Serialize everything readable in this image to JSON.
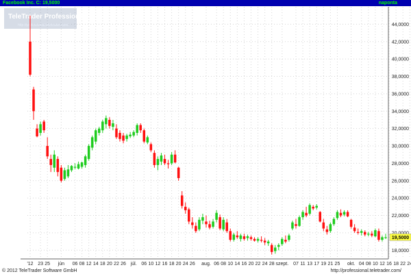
{
  "header": {
    "symbol_label": "Facebook Inc.  C: 19,5000",
    "period_label": "naponta"
  },
  "watermark": {
    "title": "TeleTrader Professional",
    "url": "http://professional.teletrader.com/"
  },
  "footer": {
    "copyright": "© 2012 TeleTrader Software GmbH",
    "url": "http://professional.teletrader.com/"
  },
  "colors": {
    "up": "#1fcc1f",
    "down": "#ff1010",
    "header_bg": "#0000b0",
    "header_text": "#00ff00",
    "grid": "#d4d4d4",
    "last_price_bg": "#ffff40"
  },
  "chart_data": {
    "type": "candlestick",
    "ylim": [
      17,
      46
    ],
    "yticks": [
      18,
      20,
      22,
      24,
      26,
      28,
      30,
      32,
      34,
      36,
      38,
      40,
      42,
      44
    ],
    "ytick_labels": [
      "18,0000",
      "20,0000",
      "22,0000",
      "24,0000",
      "26,0000",
      "28,0000",
      "30,0000",
      "32,0000",
      "34,0000",
      "36,0000",
      "38,0000",
      "40,0000",
      "42,0000",
      "44,0000"
    ],
    "grid": true,
    "last_price": 19.5,
    "last_price_label": "19,5000",
    "xtick_labels": [
      {
        "i": 0,
        "label": "'12"
      },
      {
        "i": 3,
        "label": "23"
      },
      {
        "i": 5,
        "label": "25"
      },
      {
        "i": 9,
        "label": "jún"
      },
      {
        "i": 13,
        "label": "06"
      },
      {
        "i": 15,
        "label": "08"
      },
      {
        "i": 17,
        "label": "12"
      },
      {
        "i": 19,
        "label": "14"
      },
      {
        "i": 21,
        "label": "18"
      },
      {
        "i": 23,
        "label": "20"
      },
      {
        "i": 25,
        "label": "22"
      },
      {
        "i": 27,
        "label": "26"
      },
      {
        "i": 30,
        "label": "júl."
      },
      {
        "i": 33,
        "label": "06"
      },
      {
        "i": 35,
        "label": "10"
      },
      {
        "i": 37,
        "label": "12"
      },
      {
        "i": 39,
        "label": "16"
      },
      {
        "i": 41,
        "label": "18"
      },
      {
        "i": 43,
        "label": "20"
      },
      {
        "i": 45,
        "label": "24"
      },
      {
        "i": 47,
        "label": "26"
      },
      {
        "i": 51,
        "label": "aug."
      },
      {
        "i": 54,
        "label": "06"
      },
      {
        "i": 56,
        "label": "08"
      },
      {
        "i": 58,
        "label": "10"
      },
      {
        "i": 60,
        "label": "14"
      },
      {
        "i": 62,
        "label": "16"
      },
      {
        "i": 64,
        "label": "20"
      },
      {
        "i": 66,
        "label": "22"
      },
      {
        "i": 68,
        "label": "24"
      },
      {
        "i": 70,
        "label": "28"
      },
      {
        "i": 73,
        "label": "szept."
      },
      {
        "i": 77,
        "label": "07"
      },
      {
        "i": 79,
        "label": "11"
      },
      {
        "i": 81,
        "label": "13"
      },
      {
        "i": 83,
        "label": "17"
      },
      {
        "i": 85,
        "label": "19"
      },
      {
        "i": 87,
        "label": "21"
      },
      {
        "i": 89,
        "label": "25"
      },
      {
        "i": 93,
        "label": "okt."
      },
      {
        "i": 96,
        "label": "04"
      },
      {
        "i": 98,
        "label": "08"
      },
      {
        "i": 100,
        "label": "10"
      },
      {
        "i": 102,
        "label": "12"
      },
      {
        "i": 104,
        "label": "16"
      },
      {
        "i": 106,
        "label": "18"
      },
      {
        "i": 108,
        "label": "22"
      },
      {
        "i": 110,
        "label": "24"
      }
    ],
    "candles": [
      {
        "o": 42.0,
        "h": 45.0,
        "l": 38.0,
        "c": 38.2
      },
      {
        "o": 36.5,
        "h": 36.8,
        "l": 33.0,
        "c": 34.0
      },
      {
        "o": 32.0,
        "h": 32.5,
        "l": 31.0,
        "c": 31.1
      },
      {
        "o": 31.5,
        "h": 32.8,
        "l": 31.2,
        "c": 32.5
      },
      {
        "o": 32.8,
        "h": 33.0,
        "l": 31.5,
        "c": 31.8
      },
      {
        "o": 30.0,
        "h": 31.0,
        "l": 28.5,
        "c": 28.8
      },
      {
        "o": 28.5,
        "h": 29.0,
        "l": 27.0,
        "c": 27.8
      },
      {
        "o": 27.5,
        "h": 29.5,
        "l": 27.0,
        "c": 29.0
      },
      {
        "o": 28.5,
        "h": 28.8,
        "l": 26.5,
        "c": 27.0
      },
      {
        "o": 27.5,
        "h": 27.8,
        "l": 25.8,
        "c": 26.0
      },
      {
        "o": 26.2,
        "h": 27.5,
        "l": 26.0,
        "c": 27.2
      },
      {
        "o": 26.5,
        "h": 27.8,
        "l": 26.3,
        "c": 27.3
      },
      {
        "o": 27.2,
        "h": 27.8,
        "l": 27.0,
        "c": 27.7
      },
      {
        "o": 27.5,
        "h": 28.0,
        "l": 27.3,
        "c": 27.6
      },
      {
        "o": 27.4,
        "h": 28.2,
        "l": 27.3,
        "c": 27.9
      },
      {
        "o": 27.6,
        "h": 28.2,
        "l": 27.4,
        "c": 28.1
      },
      {
        "o": 27.8,
        "h": 29.0,
        "l": 27.5,
        "c": 28.8
      },
      {
        "o": 28.5,
        "h": 30.2,
        "l": 28.3,
        "c": 30.0
      },
      {
        "o": 29.8,
        "h": 31.2,
        "l": 29.5,
        "c": 31.0
      },
      {
        "o": 30.5,
        "h": 32.0,
        "l": 30.2,
        "c": 31.8
      },
      {
        "o": 31.5,
        "h": 32.2,
        "l": 31.2,
        "c": 32.0
      },
      {
        "o": 31.8,
        "h": 33.0,
        "l": 31.5,
        "c": 32.8
      },
      {
        "o": 32.5,
        "h": 33.5,
        "l": 32.0,
        "c": 33.2
      },
      {
        "o": 33.0,
        "h": 33.3,
        "l": 32.0,
        "c": 32.3
      },
      {
        "o": 32.2,
        "h": 33.0,
        "l": 31.8,
        "c": 32.6
      },
      {
        "o": 32.0,
        "h": 32.5,
        "l": 30.8,
        "c": 31.0
      },
      {
        "o": 31.5,
        "h": 31.8,
        "l": 30.5,
        "c": 30.8
      },
      {
        "o": 31.2,
        "h": 31.5,
        "l": 30.3,
        "c": 30.6
      },
      {
        "o": 30.8,
        "h": 31.4,
        "l": 30.5,
        "c": 31.2
      },
      {
        "o": 31.1,
        "h": 31.6,
        "l": 30.9,
        "c": 31.3
      },
      {
        "o": 31.2,
        "h": 31.8,
        "l": 31.0,
        "c": 31.6
      },
      {
        "o": 31.5,
        "h": 32.6,
        "l": 31.2,
        "c": 32.4
      },
      {
        "o": 32.4,
        "h": 32.6,
        "l": 31.5,
        "c": 31.8
      },
      {
        "o": 31.8,
        "h": 32.0,
        "l": 30.3,
        "c": 30.5
      },
      {
        "o": 30.4,
        "h": 31.2,
        "l": 30.2,
        "c": 31.0
      },
      {
        "o": 30.2,
        "h": 30.4,
        "l": 29.3,
        "c": 29.5
      },
      {
        "o": 29.2,
        "h": 29.5,
        "l": 27.5,
        "c": 27.8
      },
      {
        "o": 27.8,
        "h": 28.8,
        "l": 27.2,
        "c": 28.5
      },
      {
        "o": 28.2,
        "h": 29.2,
        "l": 27.8,
        "c": 28.9
      },
      {
        "o": 28.5,
        "h": 29.0,
        "l": 27.8,
        "c": 28.0
      },
      {
        "o": 28.0,
        "h": 28.4,
        "l": 27.4,
        "c": 27.9
      },
      {
        "o": 28.0,
        "h": 29.3,
        "l": 27.8,
        "c": 29.0
      },
      {
        "o": 29.0,
        "h": 29.5,
        "l": 28.0,
        "c": 28.1
      },
      {
        "o": 27.5,
        "h": 27.6,
        "l": 26.0,
        "c": 26.3
      },
      {
        "o": 24.3,
        "h": 24.8,
        "l": 22.8,
        "c": 23.1
      },
      {
        "o": 23.0,
        "h": 23.5,
        "l": 22.2,
        "c": 22.6
      },
      {
        "o": 22.7,
        "h": 22.9,
        "l": 21.0,
        "c": 21.3
      },
      {
        "o": 21.2,
        "h": 21.8,
        "l": 20.5,
        "c": 20.9
      },
      {
        "o": 20.8,
        "h": 21.2,
        "l": 20.0,
        "c": 20.2
      },
      {
        "o": 20.4,
        "h": 21.8,
        "l": 20.2,
        "c": 21.5
      },
      {
        "o": 21.4,
        "h": 22.2,
        "l": 21.0,
        "c": 21.8
      },
      {
        "o": 21.3,
        "h": 22.0,
        "l": 20.6,
        "c": 21.0
      },
      {
        "o": 21.0,
        "h": 21.4,
        "l": 20.4,
        "c": 20.6
      },
      {
        "o": 20.7,
        "h": 21.6,
        "l": 20.5,
        "c": 21.3
      },
      {
        "o": 21.5,
        "h": 22.6,
        "l": 21.2,
        "c": 22.3
      },
      {
        "o": 21.8,
        "h": 22.1,
        "l": 20.3,
        "c": 20.5
      },
      {
        "o": 20.4,
        "h": 21.8,
        "l": 20.2,
        "c": 21.5
      },
      {
        "o": 21.2,
        "h": 21.6,
        "l": 20.0,
        "c": 20.2
      },
      {
        "o": 20.2,
        "h": 20.5,
        "l": 19.0,
        "c": 19.2
      },
      {
        "o": 19.2,
        "h": 20.0,
        "l": 19.0,
        "c": 19.8
      },
      {
        "o": 19.7,
        "h": 20.2,
        "l": 19.3,
        "c": 19.5
      },
      {
        "o": 19.3,
        "h": 19.9,
        "l": 19.0,
        "c": 19.7
      },
      {
        "o": 19.6,
        "h": 19.9,
        "l": 19.1,
        "c": 19.3
      },
      {
        "o": 19.4,
        "h": 19.8,
        "l": 19.1,
        "c": 19.6
      },
      {
        "o": 19.5,
        "h": 19.7,
        "l": 19.1,
        "c": 19.3
      },
      {
        "o": 19.3,
        "h": 19.5,
        "l": 19.0,
        "c": 19.1
      },
      {
        "o": 19.1,
        "h": 19.5,
        "l": 18.9,
        "c": 19.3
      },
      {
        "o": 19.2,
        "h": 19.6,
        "l": 18.9,
        "c": 19.1
      },
      {
        "o": 19.1,
        "h": 19.4,
        "l": 18.6,
        "c": 18.9
      },
      {
        "o": 18.8,
        "h": 19.2,
        "l": 18.5,
        "c": 19.0
      },
      {
        "o": 18.6,
        "h": 18.8,
        "l": 17.5,
        "c": 17.8
      },
      {
        "o": 17.9,
        "h": 18.6,
        "l": 17.6,
        "c": 18.3
      },
      {
        "o": 18.4,
        "h": 18.8,
        "l": 18.0,
        "c": 18.6
      },
      {
        "o": 18.7,
        "h": 19.5,
        "l": 18.5,
        "c": 19.3
      },
      {
        "o": 19.2,
        "h": 19.7,
        "l": 18.8,
        "c": 19.0
      },
      {
        "o": 19.2,
        "h": 19.9,
        "l": 19.0,
        "c": 19.7
      },
      {
        "o": 20.5,
        "h": 21.4,
        "l": 20.3,
        "c": 21.2
      },
      {
        "o": 21.0,
        "h": 21.6,
        "l": 20.5,
        "c": 20.8
      },
      {
        "o": 20.8,
        "h": 22.0,
        "l": 20.7,
        "c": 21.8
      },
      {
        "o": 21.8,
        "h": 22.6,
        "l": 21.5,
        "c": 22.4
      },
      {
        "o": 22.3,
        "h": 23.0,
        "l": 21.8,
        "c": 22.0
      },
      {
        "o": 22.2,
        "h": 23.4,
        "l": 22.0,
        "c": 23.2
      },
      {
        "o": 23.0,
        "h": 23.2,
        "l": 22.6,
        "c": 22.8
      },
      {
        "o": 22.9,
        "h": 23.3,
        "l": 22.7,
        "c": 23.1
      },
      {
        "o": 22.4,
        "h": 22.5,
        "l": 21.2,
        "c": 21.3
      },
      {
        "o": 21.2,
        "h": 21.6,
        "l": 20.2,
        "c": 20.5
      },
      {
        "o": 20.4,
        "h": 20.8,
        "l": 19.8,
        "c": 20.1
      },
      {
        "o": 20.2,
        "h": 21.2,
        "l": 20.0,
        "c": 21.0
      },
      {
        "o": 21.0,
        "h": 21.8,
        "l": 20.8,
        "c": 21.6
      },
      {
        "o": 21.7,
        "h": 22.6,
        "l": 21.5,
        "c": 22.4
      },
      {
        "o": 22.3,
        "h": 22.7,
        "l": 21.8,
        "c": 22.0
      },
      {
        "o": 22.1,
        "h": 22.6,
        "l": 21.9,
        "c": 22.4
      },
      {
        "o": 22.4,
        "h": 22.6,
        "l": 21.8,
        "c": 21.9
      },
      {
        "o": 21.5,
        "h": 21.6,
        "l": 20.5,
        "c": 20.7
      },
      {
        "o": 20.6,
        "h": 21.0,
        "l": 20.0,
        "c": 20.2
      },
      {
        "o": 20.1,
        "h": 20.5,
        "l": 19.8,
        "c": 20.0
      },
      {
        "o": 20.0,
        "h": 20.4,
        "l": 19.7,
        "c": 20.2
      },
      {
        "o": 20.1,
        "h": 20.3,
        "l": 19.6,
        "c": 19.8
      },
      {
        "o": 19.8,
        "h": 20.1,
        "l": 19.6,
        "c": 19.9
      },
      {
        "o": 19.9,
        "h": 20.2,
        "l": 19.5,
        "c": 19.7
      },
      {
        "o": 19.6,
        "h": 20.5,
        "l": 19.5,
        "c": 20.3
      },
      {
        "o": 20.2,
        "h": 20.5,
        "l": 19.0,
        "c": 19.2
      },
      {
        "o": 19.2,
        "h": 19.7,
        "l": 19.0,
        "c": 19.5
      },
      {
        "o": 19.4,
        "h": 19.9,
        "l": 19.3,
        "c": 19.5
      }
    ]
  }
}
